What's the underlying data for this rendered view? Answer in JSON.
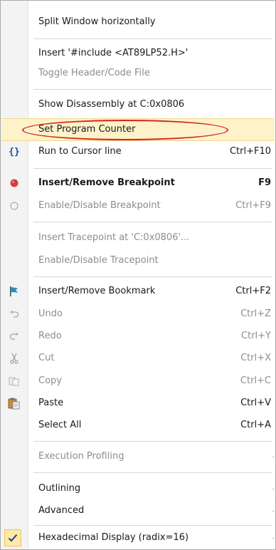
{
  "menu": {
    "items": [
      {
        "label": "Split Window horizontally",
        "shortcut": ""
      },
      {
        "label": "Insert '#include <AT89LP52.H>'",
        "shortcut": ""
      },
      {
        "label": "Toggle Header/Code File",
        "shortcut": ""
      },
      {
        "label": "Show Disassembly at C:0x0806",
        "shortcut": ""
      },
      {
        "label": "Set Program Counter",
        "shortcut": ""
      },
      {
        "label": "Run to Cursor line",
        "shortcut": "Ctrl+F10"
      },
      {
        "label": "Insert/Remove Breakpoint",
        "shortcut": "F9"
      },
      {
        "label": "Enable/Disable Breakpoint",
        "shortcut": "Ctrl+F9"
      },
      {
        "label": "Insert Tracepoint at 'C:0x0806'...",
        "shortcut": ""
      },
      {
        "label": "Enable/Disable Tracepoint",
        "shortcut": ""
      },
      {
        "label": "Insert/Remove Bookmark",
        "shortcut": "Ctrl+F2"
      },
      {
        "label": "Undo",
        "shortcut": "Ctrl+Z"
      },
      {
        "label": "Redo",
        "shortcut": "Ctrl+Y"
      },
      {
        "label": "Cut",
        "shortcut": "Ctrl+X"
      },
      {
        "label": "Copy",
        "shortcut": "Ctrl+C"
      },
      {
        "label": "Paste",
        "shortcut": "Ctrl+V"
      },
      {
        "label": "Select All",
        "shortcut": "Ctrl+A"
      },
      {
        "label": "Execution Profiling",
        "shortcut": ""
      },
      {
        "label": "Outlining",
        "shortcut": ""
      },
      {
        "label": "Advanced",
        "shortcut": ""
      },
      {
        "label": "Hexadecimal Display (radix=16)",
        "shortcut": ""
      }
    ],
    "icons": {
      "run_to_cursor": "{}"
    },
    "colors": {
      "highlight": "#fdf2c9",
      "annotation_ellipse": "#d52525",
      "breakpoint_red": "#d63c3c",
      "bookmark_teal": "#2a8fb8"
    }
  }
}
